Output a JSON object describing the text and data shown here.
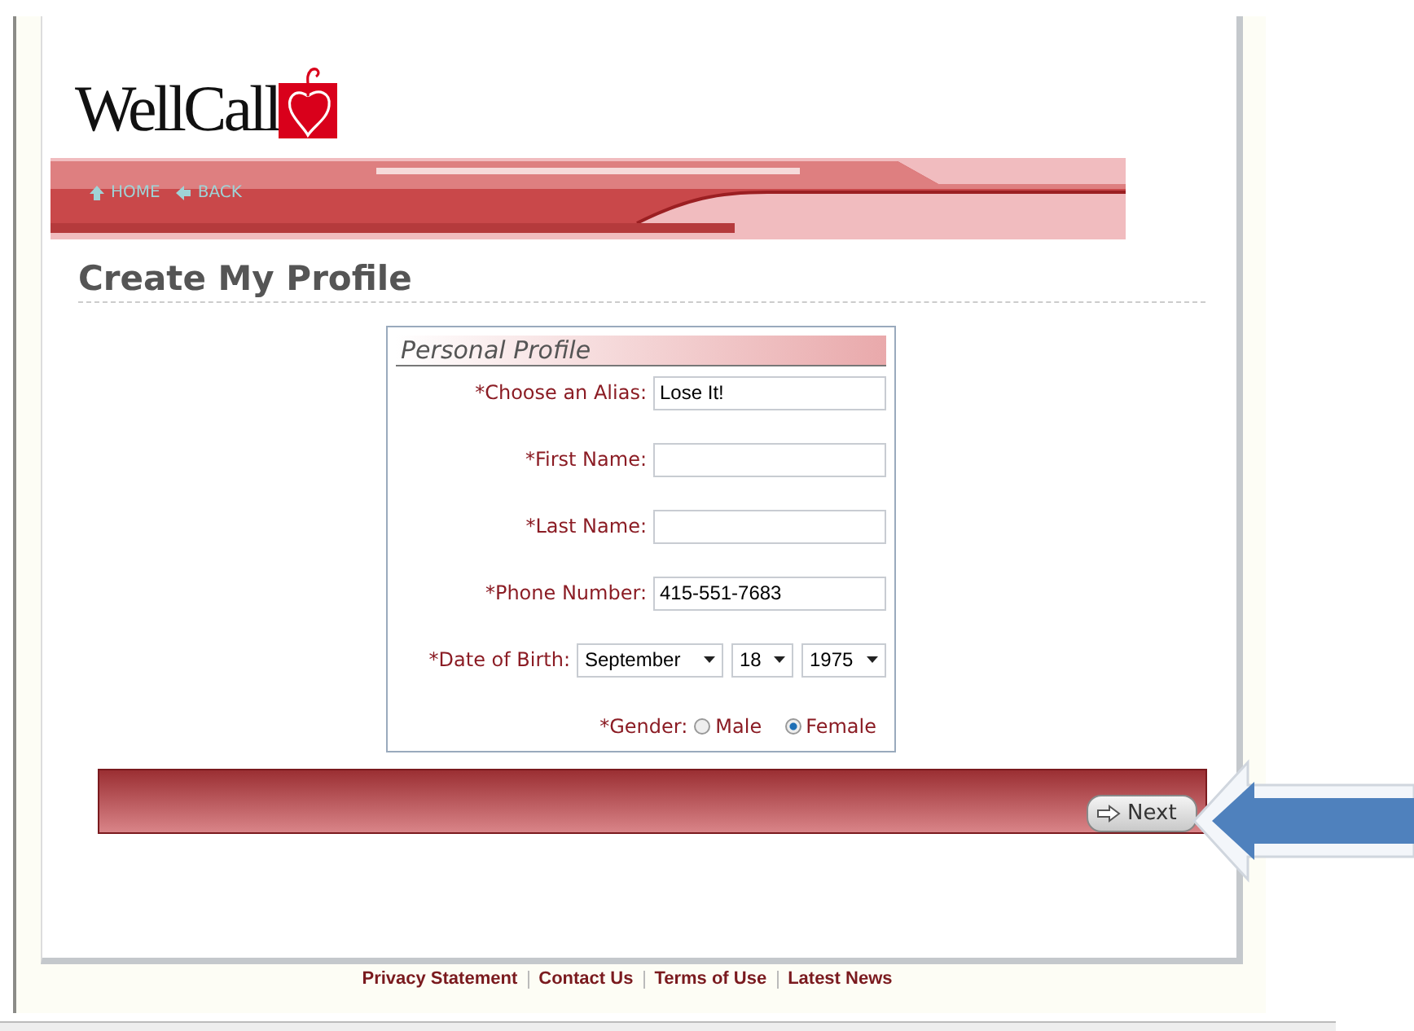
{
  "logo": {
    "text": "WellCall"
  },
  "nav": [
    {
      "label": "HOME",
      "kind": "up"
    },
    {
      "label": "BACK",
      "kind": "left"
    }
  ],
  "page_title": "Create My Profile",
  "form": {
    "legend": "Personal Profile",
    "fields": [
      {
        "kind": "text",
        "label": "*Choose an Alias:",
        "value": "Lose It!"
      },
      {
        "kind": "text",
        "label": "*First Name:"
      },
      {
        "kind": "text",
        "label": "*Last Name:"
      },
      {
        "kind": "text",
        "label": "*Phone Number:",
        "value": "415-551-7683"
      },
      {
        "kind": "date",
        "label": "*Date of Birth:",
        "selects": [
          "September",
          "18",
          "1975"
        ]
      },
      {
        "kind": "radio",
        "label": "*Gender:",
        "options": [
          {
            "label": "Male",
            "selected": false
          },
          {
            "label": "Female",
            "selected": true
          }
        ]
      }
    ]
  },
  "next_button": "Next",
  "footer_links": [
    "Privacy Statement",
    "Contact Us",
    "Terms of Use",
    "Latest News"
  ]
}
